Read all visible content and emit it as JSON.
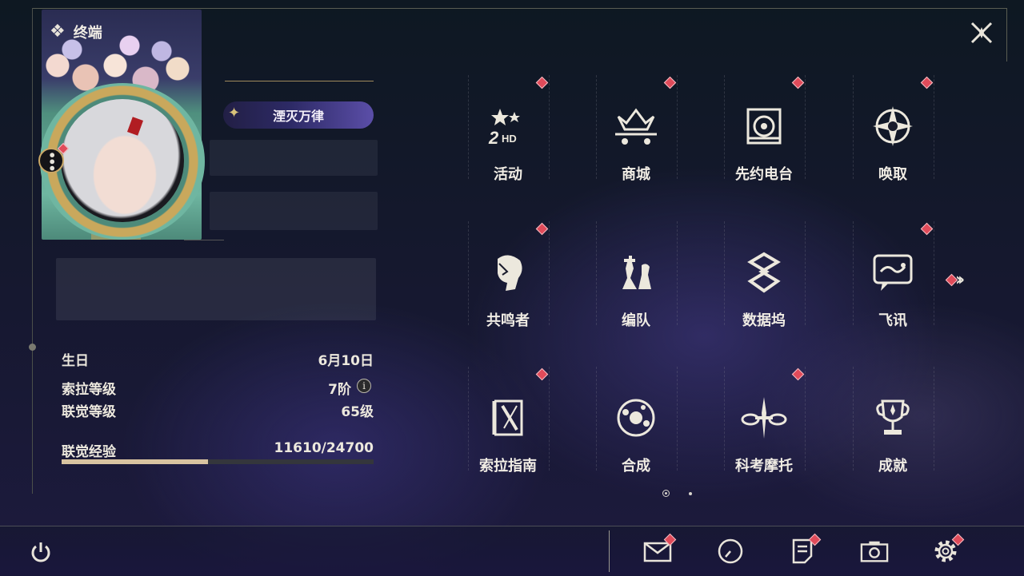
{
  "header": {
    "title": "终端"
  },
  "profile": {
    "title_badge": "湮灭万律",
    "stats": [
      {
        "label": "生日",
        "value": "6月10日"
      },
      {
        "label": "索拉等级",
        "value": "7阶"
      },
      {
        "label": "联觉等级",
        "value": "65级"
      },
      {
        "label": "联觉经验",
        "value": "11610/24700"
      }
    ],
    "xp_fraction": 0.47
  },
  "menu": {
    "items": [
      {
        "label": "活动",
        "icon": "event-2hd-icon",
        "badge": true
      },
      {
        "label": "商城",
        "icon": "shop-crown-cart-icon",
        "badge": true
      },
      {
        "label": "先约电台",
        "icon": "radio-speaker-icon",
        "badge": true
      },
      {
        "label": "唤取",
        "icon": "convene-star-icon",
        "badge": true
      },
      {
        "label": "共鸣者",
        "icon": "resonator-head-icon",
        "badge": true
      },
      {
        "label": "编队",
        "icon": "team-chess-icon",
        "badge": false
      },
      {
        "label": "数据坞",
        "icon": "data-bank-icon",
        "badge": false
      },
      {
        "label": "飞讯",
        "icon": "message-bubble-icon",
        "badge": true
      },
      {
        "label": "索拉指南",
        "icon": "guide-book-icon",
        "badge": true
      },
      {
        "label": "合成",
        "icon": "synthesis-orb-icon",
        "badge": false
      },
      {
        "label": "科考摩托",
        "icon": "motorcycle-icon",
        "badge": true
      },
      {
        "label": "成就",
        "icon": "trophy-icon",
        "badge": false
      }
    ],
    "pages": {
      "current": 1,
      "total": 2
    }
  },
  "bottom_bar": {
    "icons": [
      "mail-icon",
      "clock-icon",
      "notes-icon",
      "camera-icon",
      "settings-icon"
    ]
  },
  "colors": {
    "badge": "#e04b5a",
    "gold": "#c9a85c",
    "xp_fill": "#d8c3a0"
  }
}
